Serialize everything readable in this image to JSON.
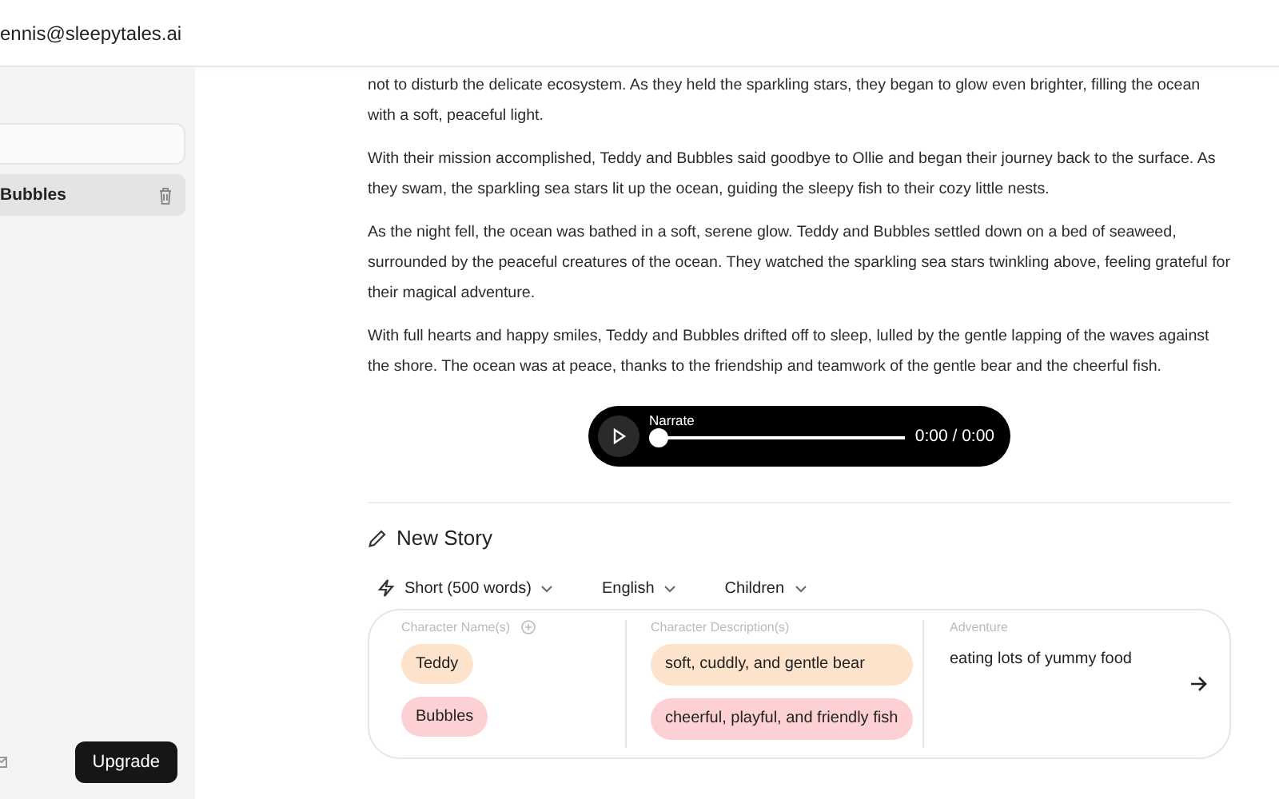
{
  "header": {
    "account_email": "ennis@sleepytales.ai"
  },
  "sidebar": {
    "stories": [
      {
        "title": "Bubbles",
        "selected": true
      }
    ],
    "upgrade_button": "Upgrade"
  },
  "story": {
    "paragraphs": [
      "not to disturb the delicate ecosystem. As they held the sparkling stars, they began to glow even brighter, filling the ocean with a soft, peaceful light.",
      "With their mission accomplished, Teddy and Bubbles said goodbye to Ollie and began their journey back to the surface. As they swam, the sparkling sea stars lit up the ocean, guiding the sleepy fish to their cozy little nests.",
      "As the night fell, the ocean was bathed in a soft, serene glow. Teddy and Bubbles settled down on a bed of seaweed, surrounded by the peaceful creatures of the ocean. They watched the sparkling sea stars twinkling above, feeling grateful for their magical adventure.",
      "With full hearts and happy smiles, Teddy and Bubbles drifted off to sleep, lulled by the gentle lapping of the waves against the shore. The ocean was at peace, thanks to the friendship and teamwork of the gentle bear and the cheerful fish."
    ],
    "player": {
      "label": "Narrate",
      "level": 0,
      "time": "0:00 / 0:00"
    }
  },
  "new_story": {
    "title": "New Story",
    "options": [
      "Short (500 words)",
      "English",
      "Children"
    ],
    "names_label": "Character Name(s)",
    "descriptions_label": "Character Description(s)",
    "adventure_label": "Adventure",
    "characters": [
      {
        "name": "Teddy",
        "description": "soft, cuddly, and gentle bear",
        "color": "#fde3cc"
      },
      {
        "name": "Bubbles",
        "description": "cheerful, playful, and friendly fish",
        "color": "#fdd0d4"
      }
    ],
    "adventure": "eating lots of yummy food"
  }
}
